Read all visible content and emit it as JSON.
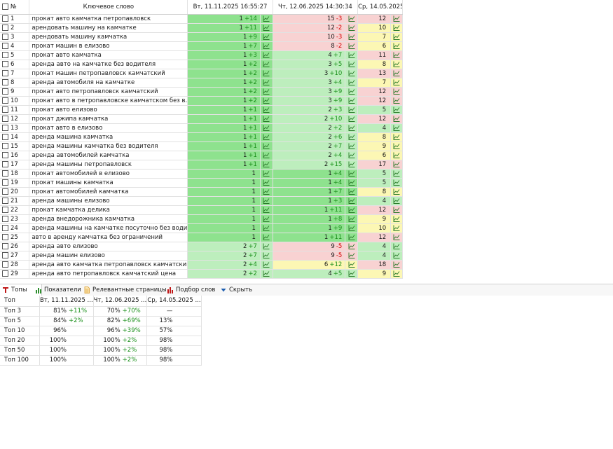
{
  "grid": {
    "headers": {
      "num": "№",
      "keyword": "Ключевое слово",
      "date1": "Вт, 11.11.2025 16:55:27",
      "date2": "Чт, 12.06.2025 14:30:34",
      "date3": "Ср, 14.05.2025..."
    },
    "icon": "line-chart-icon",
    "rows": [
      {
        "n": "1",
        "kw": "прокат авто камчатка петропавловск",
        "p1": "1",
        "d1": "+14",
        "p2": "15",
        "d2": "-3",
        "p3": "12"
      },
      {
        "n": "2",
        "kw": "арендовать машину на камчатке",
        "p1": "1",
        "d1": "+11",
        "p2": "12",
        "d2": "-2",
        "p3": "10"
      },
      {
        "n": "3",
        "kw": "арендовать машину камчатка",
        "p1": "1",
        "d1": "+9",
        "p2": "10",
        "d2": "-3",
        "p3": "7"
      },
      {
        "n": "4",
        "kw": "прокат машин в елизово",
        "p1": "1",
        "d1": "+7",
        "p2": "8",
        "d2": "-2",
        "p3": "6"
      },
      {
        "n": "5",
        "kw": "прокат авто камчатка",
        "p1": "1",
        "d1": "+3",
        "p2": "4",
        "d2": "+7",
        "p3": "11"
      },
      {
        "n": "6",
        "kw": "аренда авто на камчатке без водителя",
        "p1": "1",
        "d1": "+2",
        "p2": "3",
        "d2": "+5",
        "p3": "8"
      },
      {
        "n": "7",
        "kw": "прокат машин петропавловск камчатский",
        "p1": "1",
        "d1": "+2",
        "p2": "3",
        "d2": "+10",
        "p3": "13"
      },
      {
        "n": "8",
        "kw": "аренда автомобиля на камчатке",
        "p1": "1",
        "d1": "+2",
        "p2": "3",
        "d2": "+4",
        "p3": "7"
      },
      {
        "n": "9",
        "kw": "прокат авто петропавловск камчатский",
        "p1": "1",
        "d1": "+2",
        "p2": "3",
        "d2": "+9",
        "p3": "12"
      },
      {
        "n": "10",
        "kw": "прокат авто в петропавловске камчатском без в...",
        "p1": "1",
        "d1": "+2",
        "p2": "3",
        "d2": "+9",
        "p3": "12"
      },
      {
        "n": "11",
        "kw": "прокат авто елизово",
        "p1": "1",
        "d1": "+1",
        "p2": "2",
        "d2": "+3",
        "p3": "5"
      },
      {
        "n": "12",
        "kw": "прокат джипа камчатка",
        "p1": "1",
        "d1": "+1",
        "p2": "2",
        "d2": "+10",
        "p3": "12"
      },
      {
        "n": "13",
        "kw": "прокат авто в елизово",
        "p1": "1",
        "d1": "+1",
        "p2": "2",
        "d2": "+2",
        "p3": "4"
      },
      {
        "n": "14",
        "kw": "аренда машина камчатка",
        "p1": "1",
        "d1": "+1",
        "p2": "2",
        "d2": "+6",
        "p3": "8"
      },
      {
        "n": "15",
        "kw": "аренда машины камчатка без водителя",
        "p1": "1",
        "d1": "+1",
        "p2": "2",
        "d2": "+7",
        "p3": "9"
      },
      {
        "n": "16",
        "kw": "аренда автомобилей камчатка",
        "p1": "1",
        "d1": "+1",
        "p2": "2",
        "d2": "+4",
        "p3": "6"
      },
      {
        "n": "17",
        "kw": "аренда машины петропавловск",
        "p1": "1",
        "d1": "+1",
        "p2": "2",
        "d2": "+15",
        "p3": "17"
      },
      {
        "n": "18",
        "kw": "прокат автомобилей в елизово",
        "p1": "1",
        "d1": "",
        "p2": "1",
        "d2": "+4",
        "p3": "5"
      },
      {
        "n": "19",
        "kw": "прокат машины камчатка",
        "p1": "1",
        "d1": "",
        "p2": "1",
        "d2": "+4",
        "p3": "5"
      },
      {
        "n": "20",
        "kw": "прокат автомобилей камчатка",
        "p1": "1",
        "d1": "",
        "p2": "1",
        "d2": "+7",
        "p3": "8"
      },
      {
        "n": "21",
        "kw": "аренда машины елизово",
        "p1": "1",
        "d1": "",
        "p2": "1",
        "d2": "+3",
        "p3": "4"
      },
      {
        "n": "22",
        "kw": "прокат камчатка делика",
        "p1": "1",
        "d1": "",
        "p2": "1",
        "d2": "+11",
        "p3": "12"
      },
      {
        "n": "23",
        "kw": "аренда внедорожника камчатка",
        "p1": "1",
        "d1": "",
        "p2": "1",
        "d2": "+8",
        "p3": "9"
      },
      {
        "n": "24",
        "kw": "аренда машины на камчатке посуточно без води...",
        "p1": "1",
        "d1": "",
        "p2": "1",
        "d2": "+9",
        "p3": "10"
      },
      {
        "n": "25",
        "kw": "авто в аренду камчатка без ограничений",
        "p1": "1",
        "d1": "",
        "p2": "1",
        "d2": "+11",
        "p3": "12"
      },
      {
        "n": "26",
        "kw": "аренда авто елизово",
        "p1": "2",
        "d1": "+7",
        "p2": "9",
        "d2": "-5",
        "p3": "4"
      },
      {
        "n": "27",
        "kw": "аренда машин елизово",
        "p1": "2",
        "d1": "+7",
        "p2": "9",
        "d2": "-5",
        "p3": "4"
      },
      {
        "n": "28",
        "kw": "аренда авто камчатка петропавловск камчатский",
        "p1": "2",
        "d1": "+4",
        "p2": "6",
        "d2": "+12",
        "p3": "18"
      },
      {
        "n": "29",
        "kw": "аренда авто петропавловск камчатский цена",
        "p1": "2",
        "d1": "+2",
        "p2": "4",
        "d2": "+5",
        "p3": "9"
      }
    ]
  },
  "ellipsis": "...",
  "tabs": [
    {
      "label": "Топы",
      "icon": "tops-icon",
      "active": true
    },
    {
      "label": "Показатели",
      "icon": "bar-chart-icon",
      "active": false
    },
    {
      "label": "Релевантные страницы",
      "icon": "document-icon",
      "active": false
    },
    {
      "label": "Подбор слов",
      "icon": "bar-chart-icon",
      "active": false
    },
    {
      "label": "Скрыть",
      "icon": "chevron-down-icon",
      "active": false
    }
  ],
  "tops": {
    "headers": {
      "label": "Топ",
      "d1": "Вт, 11.11.2025 ...",
      "d2": "Чт, 12.06.2025 ...",
      "d3": "Ср, 14.05.2025 ..."
    },
    "rows": [
      {
        "label": "Топ 3",
        "v1": "81%",
        "dv1": "+11%",
        "v2": "70%",
        "dv2": "+70%",
        "v3": "—"
      },
      {
        "label": "Топ 5",
        "v1": "84%",
        "dv1": "+2%",
        "v2": "82%",
        "dv2": "+69%",
        "v3": "13%"
      },
      {
        "label": "Топ 10",
        "v1": "96%",
        "dv1": "",
        "v2": "96%",
        "dv2": "+39%",
        "v3": "57%"
      },
      {
        "label": "Топ 20",
        "v1": "100%",
        "dv1": "",
        "v2": "100%",
        "dv2": "+2%",
        "v3": "98%"
      },
      {
        "label": "Топ 50",
        "v1": "100%",
        "dv1": "",
        "v2": "100%",
        "dv2": "+2%",
        "v3": "98%"
      },
      {
        "label": "Топ 100",
        "v1": "100%",
        "dv1": "",
        "v2": "100%",
        "dv2": "+2%",
        "v3": "98%"
      }
    ]
  },
  "colors": {
    "green_strong": "#8ee28e",
    "green_light": "#bdeebd",
    "yellow": "#fcf7b4",
    "red": "#f8d2d2",
    "up": "#1a8f1a",
    "down": "#d40000"
  }
}
